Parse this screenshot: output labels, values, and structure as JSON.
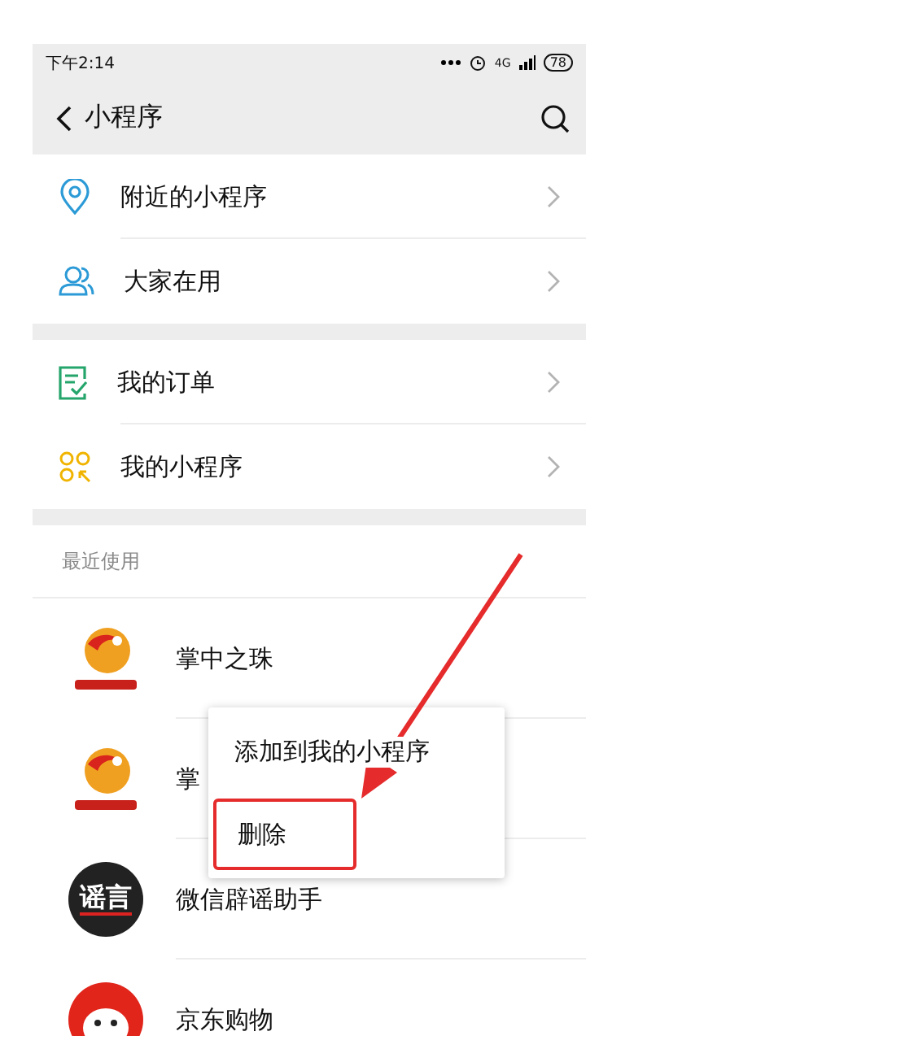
{
  "status_bar": {
    "time": "下午2:14",
    "network": "4G",
    "battery": "78"
  },
  "header": {
    "title": "小程序"
  },
  "sections": [
    {
      "items": [
        {
          "kind": "pin",
          "label": "附近的小程序"
        },
        {
          "kind": "people",
          "label": "大家在用"
        }
      ]
    },
    {
      "items": [
        {
          "kind": "order",
          "label": "我的订单"
        },
        {
          "kind": "grid",
          "label": "我的小程序"
        }
      ]
    }
  ],
  "recent": {
    "title": "最近使用",
    "items": [
      {
        "kind": "pearl",
        "name": "掌中之珠"
      },
      {
        "kind": "pearl",
        "name": "掌"
      },
      {
        "kind": "rumor",
        "logo_text": "谣言",
        "name": "微信辟谣助手"
      },
      {
        "kind": "dog",
        "name": "京东购物"
      }
    ]
  },
  "context_menu": {
    "items": [
      {
        "label": "添加到我的小程序",
        "highlighted": false
      },
      {
        "label": "删除",
        "highlighted": true
      }
    ]
  }
}
